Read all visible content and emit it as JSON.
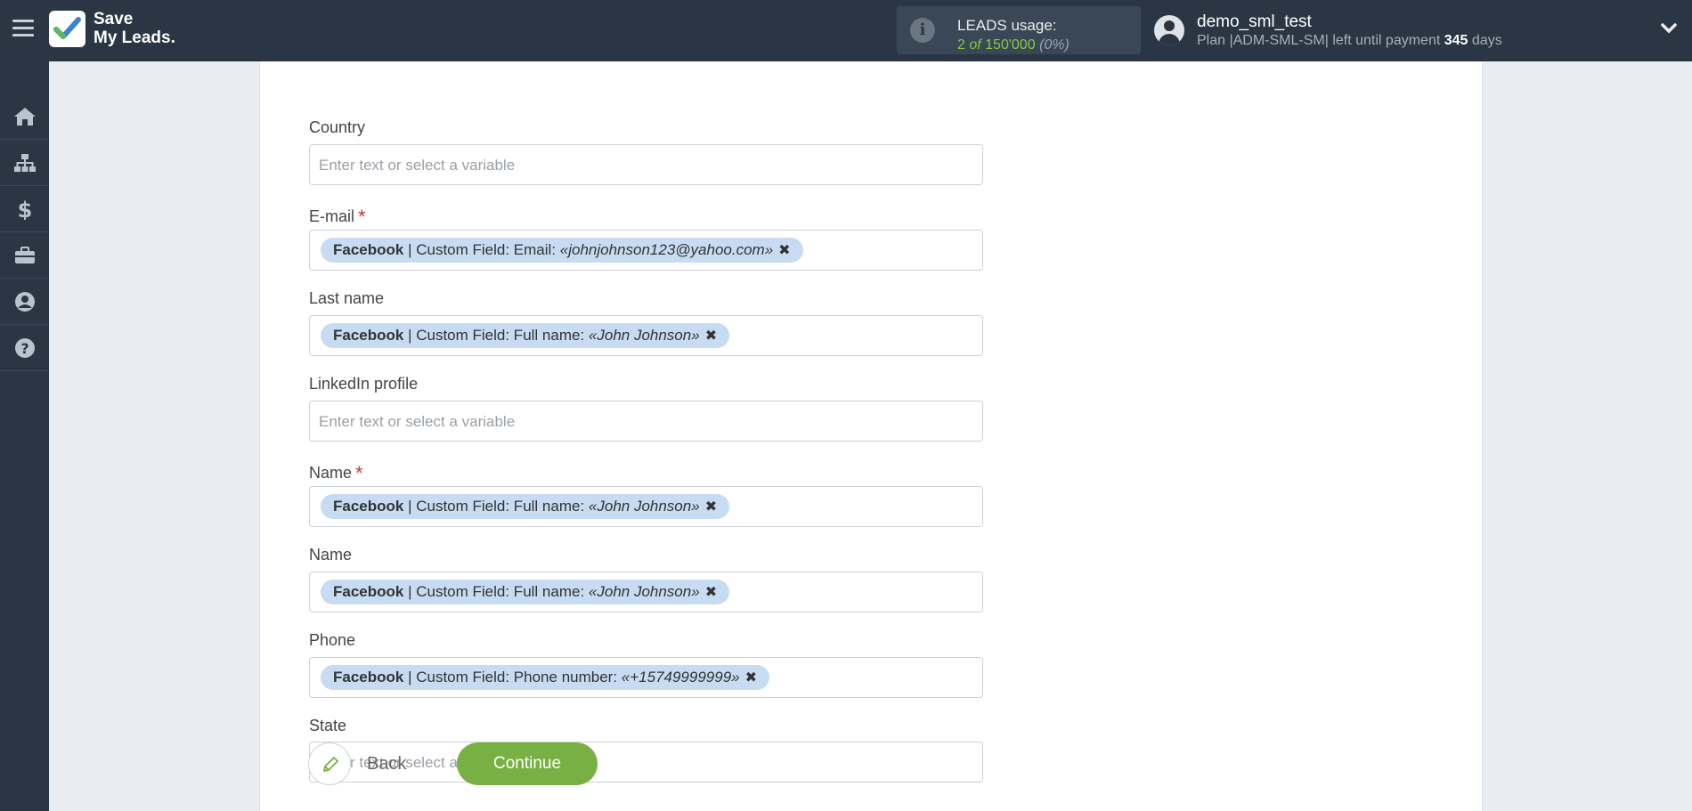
{
  "header": {
    "logo_line1": "Save",
    "logo_line2": "My Leads.",
    "usage_title": "LEADS usage:",
    "usage_used": "2",
    "usage_of": "of",
    "usage_total": "150'000",
    "usage_percent": "(0%)",
    "user_name": "demo_sml_test",
    "plan_prefix": "Plan |ADM-SML-SM| left until payment",
    "plan_days": "345",
    "plan_suffix": "days"
  },
  "sidebar": {
    "items": [
      "home-icon",
      "sitemap-icon",
      "dollar-icon",
      "briefcase-icon",
      "user-circle-icon",
      "question-circle-icon"
    ]
  },
  "form": {
    "placeholder": "Enter text or select a variable",
    "fields": [
      {
        "label": "Country",
        "required": false
      },
      {
        "label": "E-mail",
        "required": true,
        "tag": {
          "source": "Facebook",
          "text": " | Custom Field: Email: ",
          "value": "«johnjohnson123@yahoo.com»"
        }
      },
      {
        "label": "Last name",
        "required": false,
        "tag": {
          "source": "Facebook",
          "text": " | Custom Field: Full name: ",
          "value": "«John Johnson»"
        }
      },
      {
        "label": "LinkedIn profile",
        "required": false
      },
      {
        "label": "Name",
        "required": true,
        "tag": {
          "source": "Facebook",
          "text": " | Custom Field: Full name: ",
          "value": "«John Johnson»"
        }
      },
      {
        "label": "Name",
        "required": false,
        "tag": {
          "source": "Facebook",
          "text": " | Custom Field: Full name: ",
          "value": "«John Johnson»"
        }
      },
      {
        "label": "Phone",
        "required": false,
        "tag": {
          "source": "Facebook",
          "text": " | Custom Field: Phone number: ",
          "value": "«+15749999999»"
        }
      },
      {
        "label": "State",
        "required": false
      }
    ],
    "required_mark": "*",
    "remove_mark": "✖",
    "back_label": "Back",
    "continue_label": "Continue"
  }
}
